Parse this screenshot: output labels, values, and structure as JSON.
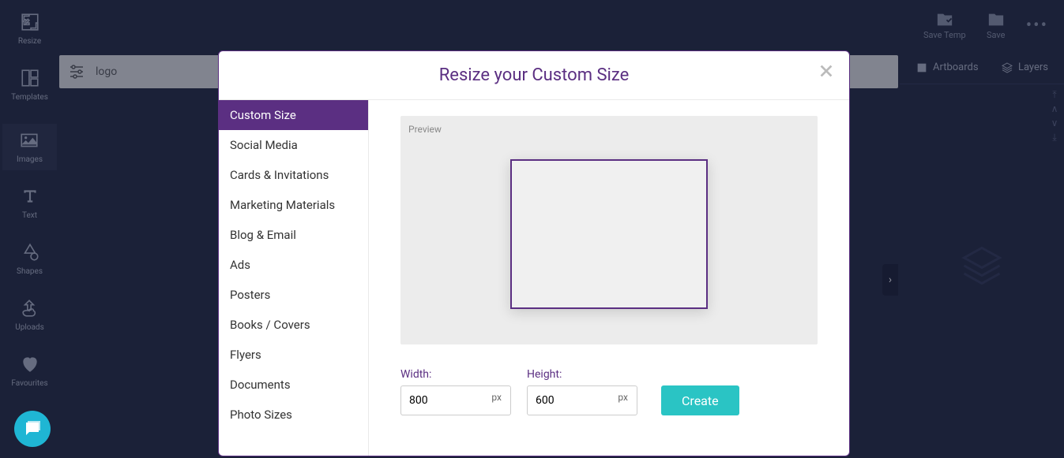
{
  "left_sidebar": {
    "items": [
      {
        "name": "resize",
        "label": "Resize"
      },
      {
        "name": "templates",
        "label": "Templates"
      },
      {
        "name": "images",
        "label": "Images"
      },
      {
        "name": "text",
        "label": "Text"
      },
      {
        "name": "shapes",
        "label": "Shapes"
      },
      {
        "name": "uploads",
        "label": "Uploads"
      },
      {
        "name": "favourites",
        "label": "Favourites"
      }
    ]
  },
  "top_bar": {
    "save_temp": "Save Temp",
    "save": "Save"
  },
  "search": {
    "value": "logo"
  },
  "right_panel": {
    "artboards": "Artboards",
    "layers": "Layers"
  },
  "modal": {
    "title": "Resize your Custom Size",
    "categories": [
      "Custom Size",
      "Social Media",
      "Cards & Invitations",
      "Marketing Materials",
      "Blog & Email",
      "Ads",
      "Posters",
      "Books / Covers",
      "Flyers",
      "Documents",
      "Photo Sizes"
    ],
    "active_category_index": 0,
    "preview_label": "Preview",
    "width_label": "Width:",
    "height_label": "Height:",
    "width_value": "800",
    "height_value": "600",
    "unit": "px",
    "create_label": "Create"
  }
}
